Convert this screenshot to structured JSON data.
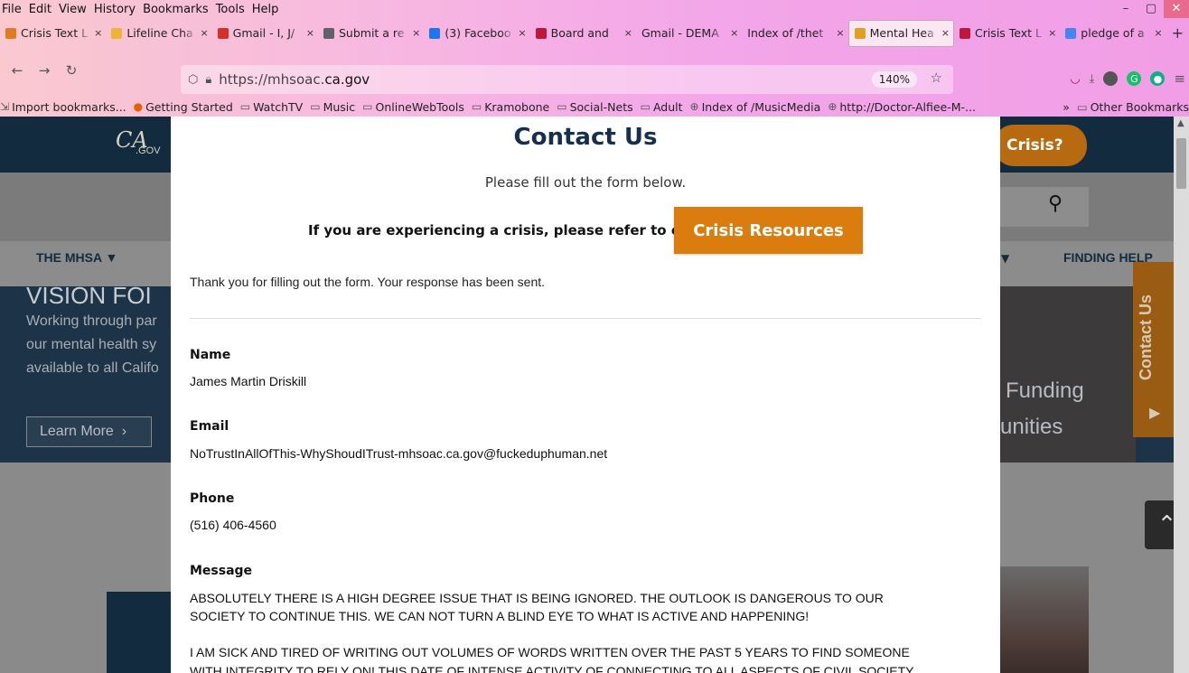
{
  "menubar": [
    "File",
    "Edit",
    "View",
    "History",
    "Bookmarks",
    "Tools",
    "Help"
  ],
  "window_controls": [
    "–",
    "▢",
    "✕"
  ],
  "tabs": [
    {
      "label": "Crisis Text L",
      "icon": "crisis-text-icon",
      "color": "#e07b22"
    },
    {
      "label": "Lifeline Cha",
      "icon": "lifeline-icon",
      "color": "#f2b233"
    },
    {
      "label": "Gmail - I, J/",
      "icon": "gmail-icon",
      "color": "#d93025"
    },
    {
      "label": "Submit a re",
      "icon": "submit-icon",
      "color": "#5f6368"
    },
    {
      "label": "(3) Faceboo",
      "icon": "facebook-icon",
      "color": "#1877f2"
    },
    {
      "label": "Board and",
      "icon": "board-icon",
      "color": "#c0163a"
    },
    {
      "label": "Gmail - DEMA",
      "icon": "none",
      "color": ""
    },
    {
      "label": "Index of /thet",
      "icon": "none",
      "color": ""
    },
    {
      "label": "Mental Hea",
      "icon": "mental-health-icon",
      "color": "#e0a020",
      "active": true
    },
    {
      "label": "Crisis Text L",
      "icon": "crisis-text-icon",
      "color": "#c0163a"
    },
    {
      "label": "pledge of a",
      "icon": "google-icon",
      "color": "#4285f4"
    }
  ],
  "navbar": {
    "url_prefix": "https://mhsoac.",
    "url_domain": "ca.gov",
    "zoom": "140%"
  },
  "bookmarks": [
    {
      "label": "Import bookmarks...",
      "icon": "import-icon"
    },
    {
      "label": "Getting Started",
      "icon": "firefox-icon"
    },
    {
      "label": "WatchTV",
      "icon": "folder-icon"
    },
    {
      "label": "Music",
      "icon": "folder-icon"
    },
    {
      "label": "OnlineWebTools",
      "icon": "folder-icon"
    },
    {
      "label": "Kramobone",
      "icon": "folder-icon"
    },
    {
      "label": "Social-Nets",
      "icon": "folder-icon"
    },
    {
      "label": "Adult",
      "icon": "folder-icon"
    },
    {
      "label": "Index of /MusicMedia",
      "icon": "globe-icon"
    },
    {
      "label": "http://Doctor-Alfiee-M-...",
      "icon": "globe-icon"
    }
  ],
  "bookmarks_overflow": "»",
  "other_bookmarks": "Other Bookmarks",
  "site": {
    "logo_main": "CA",
    "logo_sub": ".GOV",
    "crisis_pill": "Crisis?",
    "nav_mhsa": "THE MHSA",
    "nav_finding_help": "FINDING HELP",
    "hero_line1": "Working through par",
    "hero_line2": "our mental health sy",
    "hero_line3": "available to all Califo",
    "hero_funding": "Funding",
    "hero_unities": "unities",
    "learn_more": "Learn More",
    "contact_tab": "Contact Us",
    "vision_fragment": "VISION FOI"
  },
  "modal": {
    "title": "Contact Us",
    "subtitle": "Please fill out the form below.",
    "crisis_text": "If you are experiencing a crisis, please refer to our",
    "crisis_button": "Crisis Resources",
    "thanks": "Thank you for filling out the form. Your response has been sent.",
    "fields": [
      {
        "label": "Name",
        "value": "James Martin Driskill"
      },
      {
        "label": "Email",
        "value": "NoTrustInAllOfThis-WhyShoudITrust-mhsoac.ca.gov@fuckeduphuman.net"
      },
      {
        "label": "Phone",
        "value": "(516) 406-4560"
      }
    ],
    "message_label": "Message",
    "message_lines": [
      "ABSOLUTELY THERE IS A HIGH DEGREE ISSUE THAT IS BEING IGNORED. THE OUTLOOK IS DANGEROUS TO OUR",
      "SOCIETY TO CONTINUE THIS. WE CAN NOT TURN A BLIND EYE TO WHAT IS ACTIVE AND HAPPENING!",
      "I AM SICK AND TIRED OF WRITING OUT VOLUMES OF WORDS WRITTEN OVER THE PAST 5 YEARS TO FIND SOMEONE",
      "WITH INTEGRITY TO RELY ON! THIS DATE OF INTENSE ACTIVITY OF CONNECTING TO ALL ASPECTS OF CIVIL SOCIETY"
    ]
  }
}
